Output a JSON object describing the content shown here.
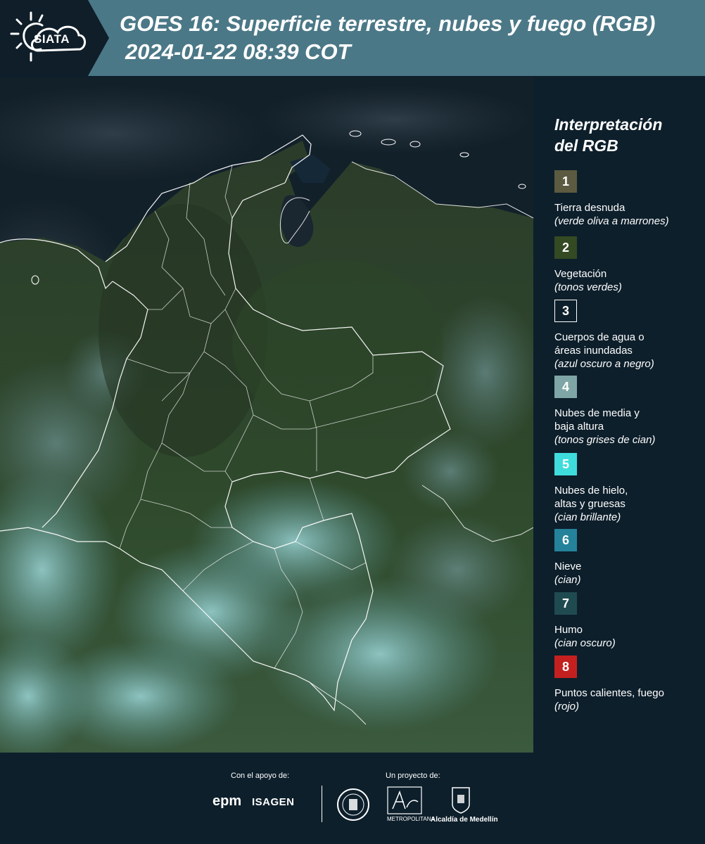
{
  "header": {
    "logo_text": "SIATA",
    "title": "GOES 16: Superficie terrestre, nubes y fuego (RGB)",
    "timestamp": "2024-01-22 08:39 COT"
  },
  "legend": {
    "title_line1": "Interpretación",
    "title_line2": "del RGB",
    "items": [
      {
        "number": "1",
        "label": "Tierra desnuda",
        "desc": "(verde oliva a marrones)",
        "color": "#5c5a40"
      },
      {
        "number": "2",
        "label": "Vegetación",
        "desc": "(tonos verdes)",
        "color": "#334a22"
      },
      {
        "number": "3",
        "label": "Cuerpos de agua o",
        "label2": "áreas inundadas",
        "desc": "(azul oscuro a negro)",
        "color": "#0d1f2b"
      },
      {
        "number": "4",
        "label": "Nubes de media y",
        "label2": "baja altura",
        "desc": "(tonos grises de cian)",
        "color": "#7fa6a6"
      },
      {
        "number": "5",
        "label": "Nubes de hielo,",
        "label2": "altas y gruesas",
        "desc": "(cian brillante)",
        "color": "#3fdcdc"
      },
      {
        "number": "6",
        "label": "Nieve",
        "desc": "(cian)",
        "color": "#24839a"
      },
      {
        "number": "7",
        "label": "Humo",
        "desc": "(cian oscuro)",
        "color": "#1f4b50"
      },
      {
        "number": "8",
        "label": "Puntos calientes, fuego",
        "desc": "(rojo)",
        "color": "#c42020"
      }
    ]
  },
  "footer": {
    "support_label": "Con el apoyo de:",
    "project_label": "Un proyecto de:",
    "epm": "epm",
    "isagen": "ISAGEN",
    "metro_label": "METROPOLITANA",
    "alcaldia": "Alcaldía de Medellín"
  }
}
